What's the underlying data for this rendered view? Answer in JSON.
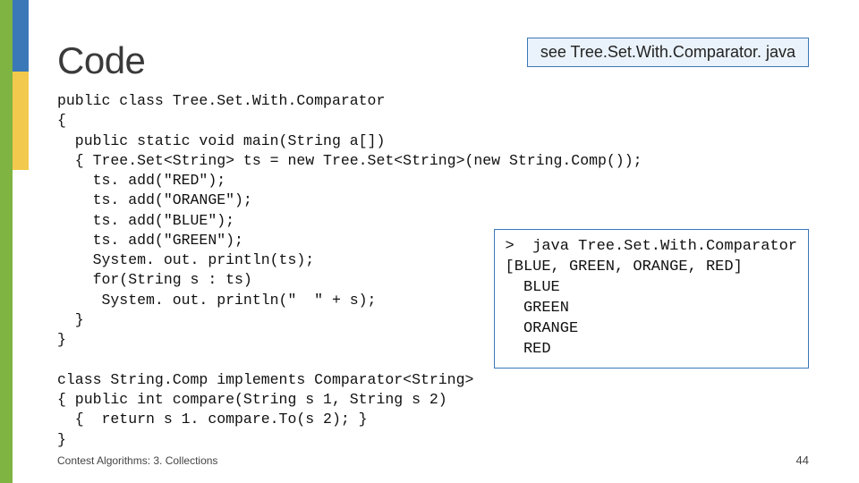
{
  "title": "Code",
  "link_caption": "see Tree.Set.With.Comparator. java",
  "code_block": "public class Tree.Set.With.Comparator\n{\n  public static void main(String a[])\n  { Tree.Set<String> ts = new Tree.Set<String>(new String.Comp());\n    ts. add(\"RED\");\n    ts. add(\"ORANGE\");\n    ts. add(\"BLUE\");\n    ts. add(\"GREEN\");\n    System. out. println(ts);\n    for(String s : ts)\n     System. out. println(\"  \" + s);\n  }\n}\n\nclass String.Comp implements Comparator<String>\n{ public int compare(String s 1, String s 2)\n  {  return s 1. compare.To(s 2); }\n}",
  "output_block": ">  java Tree.Set.With.Comparator\n[BLUE, GREEN, ORANGE, RED]\n  BLUE\n  GREEN\n  ORANGE\n  RED",
  "footer_left": "Contest Algorithms: 3. Collections",
  "footer_right": "44"
}
